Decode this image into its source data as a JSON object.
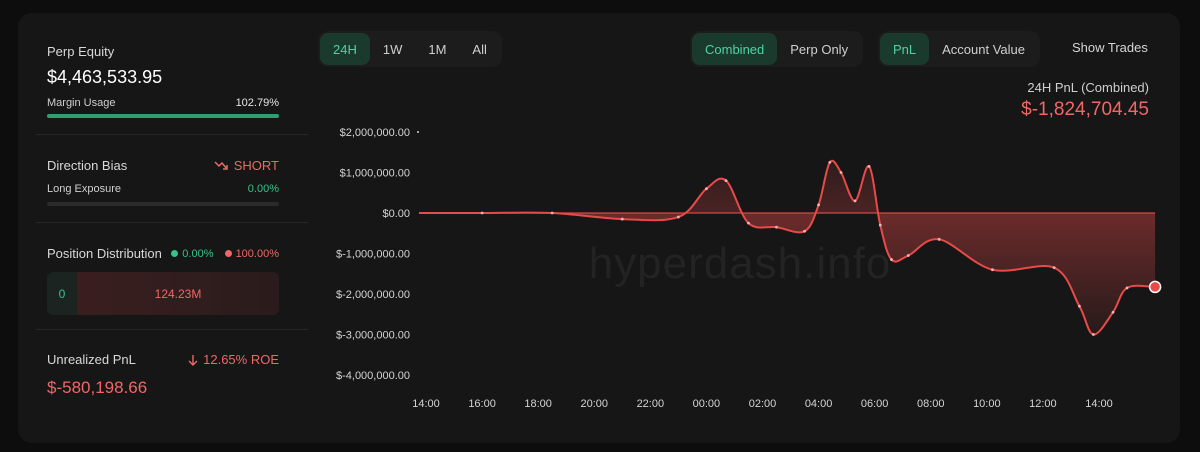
{
  "left_panel": {
    "perp_equity": {
      "label": "Perp Equity",
      "value": "$4,463,533.95"
    },
    "margin_usage": {
      "label": "Margin Usage",
      "value": "102.79%",
      "fill_fraction": 1.0
    },
    "direction_bias": {
      "label": "Direction Bias",
      "value": "SHORT",
      "icon": "trend-down-icon"
    },
    "long_exposure": {
      "label": "Long Exposure",
      "value": "0.00%",
      "fill_fraction": 0.0
    },
    "position_distribution": {
      "label": "Position Distribution",
      "long_pct": "0.00%",
      "short_pct": "100.00%",
      "long_value": "0",
      "short_value": "124.23M"
    },
    "unrealized_pnl": {
      "label": "Unrealized PnL",
      "roe": "12.65% ROE",
      "roe_icon": "arrow-down-icon",
      "value": "$-580,198.66"
    }
  },
  "toolbar": {
    "ranges": [
      "24H",
      "1W",
      "1M",
      "All"
    ],
    "active_range": "24H",
    "modes": [
      "Combined",
      "Perp Only"
    ],
    "active_mode": "Combined",
    "metrics": [
      "PnL",
      "Account Value"
    ],
    "active_metric": "PnL",
    "show_trades": "Show Trades"
  },
  "summary": {
    "label": "24H PnL (Combined)",
    "value": "$-1,824,704.45"
  },
  "watermark": "hyperdash.info",
  "colors": {
    "accent_green": "#35c28b",
    "loss_red": "#f06767",
    "line_red": "#e84a4a"
  },
  "chart_data": {
    "type": "area",
    "y_ticks": [
      "$2,000,000.00",
      "$1,000,000.00",
      "$0.00",
      "$-1,000,000.00",
      "$-2,000,000.00",
      "$-3,000,000.00",
      "$-4,000,000.00"
    ],
    "y_tick_values": [
      2000000,
      1000000,
      0,
      -1000000,
      -2000000,
      -3000000,
      -4000000
    ],
    "x_ticks": [
      "14:00",
      "16:00",
      "18:00",
      "20:00",
      "22:00",
      "00:00",
      "02:00",
      "04:00",
      "06:00",
      "08:00",
      "10:00",
      "12:00",
      "14:00"
    ],
    "x_tick_hours": [
      0,
      2,
      4,
      6,
      8,
      10,
      12,
      14,
      16,
      18,
      20,
      22,
      24
    ],
    "ylim": [
      -4000000,
      2000000
    ],
    "points": [
      {
        "x": -0.25,
        "y": 0
      },
      {
        "x": 2,
        "y": 0
      },
      {
        "x": 4.5,
        "y": 0
      },
      {
        "x": 7,
        "y": -150000
      },
      {
        "x": 9,
        "y": -100000
      },
      {
        "x": 10,
        "y": 600000
      },
      {
        "x": 10.7,
        "y": 800000
      },
      {
        "x": 11.5,
        "y": -250000
      },
      {
        "x": 12.5,
        "y": -350000
      },
      {
        "x": 13.5,
        "y": -450000
      },
      {
        "x": 14,
        "y": 200000
      },
      {
        "x": 14.4,
        "y": 1250000
      },
      {
        "x": 14.8,
        "y": 1000000
      },
      {
        "x": 15.3,
        "y": 300000
      },
      {
        "x": 15.8,
        "y": 1150000
      },
      {
        "x": 16.2,
        "y": -300000
      },
      {
        "x": 16.6,
        "y": -1150000
      },
      {
        "x": 17.2,
        "y": -1050000
      },
      {
        "x": 18.3,
        "y": -650000
      },
      {
        "x": 20.2,
        "y": -1400000
      },
      {
        "x": 22.4,
        "y": -1350000
      },
      {
        "x": 23.3,
        "y": -2300000
      },
      {
        "x": 23.8,
        "y": -3000000
      },
      {
        "x": 24.5,
        "y": -2450000
      },
      {
        "x": 25,
        "y": -1850000
      },
      {
        "x": 26,
        "y": -1824704
      }
    ]
  }
}
